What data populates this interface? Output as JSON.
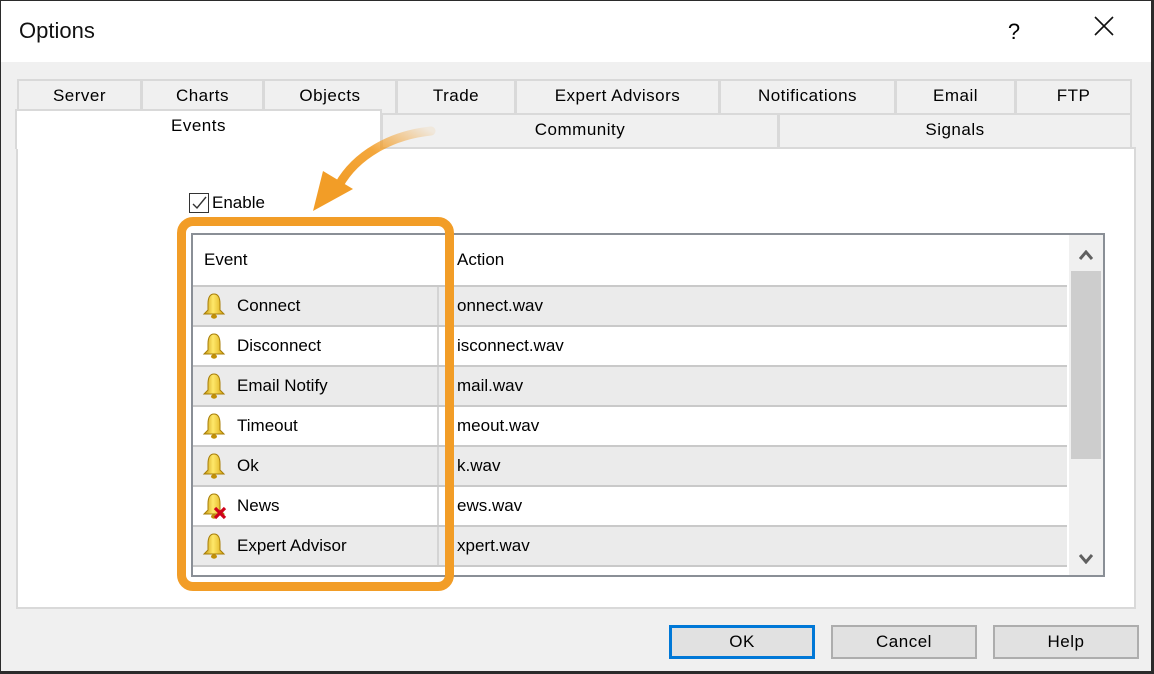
{
  "window": {
    "title": "Options",
    "help_label": "?",
    "close_icon": "close-icon"
  },
  "tabs": {
    "row1": [
      {
        "label": "Server"
      },
      {
        "label": "Charts"
      },
      {
        "label": "Objects"
      },
      {
        "label": "Trade"
      },
      {
        "label": "Expert Advisors"
      },
      {
        "label": "Notifications"
      },
      {
        "label": "Email"
      },
      {
        "label": "FTP"
      }
    ],
    "row2": [
      {
        "label": "Events",
        "active": true
      },
      {
        "label": "Community"
      },
      {
        "label": "Signals"
      }
    ]
  },
  "events_panel": {
    "enable_label": "Enable",
    "enable_checked": true,
    "columns": {
      "event": "Event",
      "action": "Action"
    },
    "rows": [
      {
        "event": "Connect",
        "action": "onnect.wav",
        "icon": "bell-icon"
      },
      {
        "event": "Disconnect",
        "action": "isconnect.wav",
        "icon": "bell-icon"
      },
      {
        "event": "Email Notify",
        "action": "mail.wav",
        "icon": "bell-icon"
      },
      {
        "event": "Timeout",
        "action": "meout.wav",
        "icon": "bell-icon"
      },
      {
        "event": "Ok",
        "action": "k.wav",
        "icon": "bell-icon"
      },
      {
        "event": "News",
        "action": "ews.wav",
        "icon": "bell-disabled-icon"
      },
      {
        "event": "Expert Advisor",
        "action": "xpert.wav",
        "icon": "bell-icon"
      }
    ],
    "scroll": {
      "position": 0.0,
      "visible_fraction": 0.55
    }
  },
  "annotation": {
    "highlight_color": "#f29d27",
    "target": "Event column"
  },
  "buttons": {
    "ok": "OK",
    "cancel": "Cancel",
    "help": "Help"
  },
  "colors": {
    "accent": "#0078d7",
    "highlight": "#f29d27"
  }
}
